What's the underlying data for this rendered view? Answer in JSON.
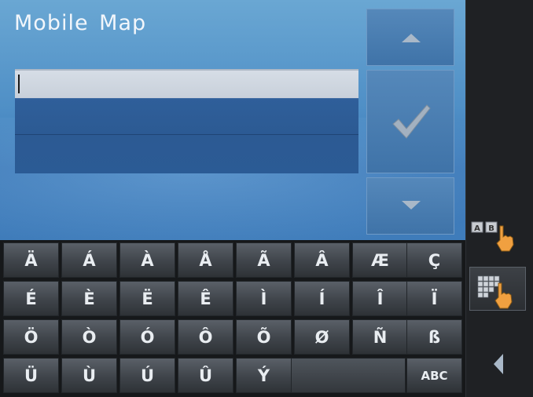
{
  "app": {
    "title": "Mobile Map"
  },
  "input": {
    "value": ""
  },
  "icons": {
    "up": "triangle-up-icon",
    "confirm": "check-icon",
    "down": "triangle-down-icon",
    "ab_mode": "ab-keyboard-pointer-icon",
    "grid_mode": "grid-keyboard-pointer-icon",
    "back": "triangle-left-icon"
  },
  "colors": {
    "pane_top": "#6aa7d3",
    "pane_bottom": "#3f7cba",
    "list_bg": "#2c5a93",
    "key_text": "#e9edf1",
    "pointer_hand": "#f0a040"
  },
  "ab_labels": [
    "A",
    "B"
  ],
  "keyboard": {
    "rows": [
      [
        "Ä",
        "Á",
        "À",
        "Å",
        "Ã",
        "Â",
        "Æ",
        "Ç"
      ],
      [
        "É",
        "È",
        "Ë",
        "Ê",
        "Ì",
        "Í",
        "Î",
        "Ï"
      ],
      [
        "Ö",
        "Ò",
        "Ó",
        "Ô",
        "Õ",
        "Ø",
        "Ñ",
        "ß"
      ],
      [
        "Ü",
        "Ù",
        "Ú",
        "Û",
        "Ý"
      ]
    ],
    "abc_label": "ABC"
  }
}
